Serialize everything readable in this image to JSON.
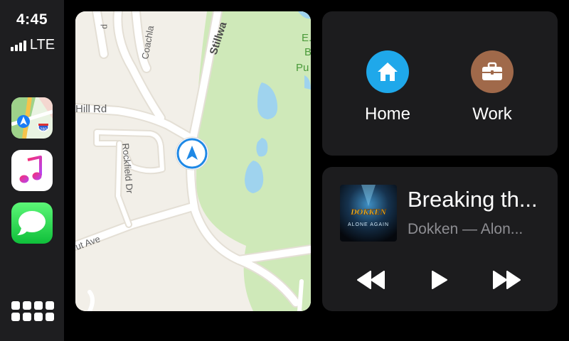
{
  "status": {
    "time": "4:45",
    "network": "LTE",
    "signal_bars": 4
  },
  "sidebar": {
    "apps": [
      {
        "name": "maps",
        "icon": "maps-app-icon",
        "badge": "280"
      },
      {
        "name": "music",
        "icon": "music-app-icon"
      },
      {
        "name": "messages",
        "icon": "messages-app-icon"
      }
    ],
    "launcher_icon": "app-grid-icon"
  },
  "map": {
    "labels": {
      "road_hill": "Hill Rd",
      "road_coachlamp": "Coachla",
      "road_stillwater": "Stillwa",
      "road_rockfield": "Rockfield Dr",
      "road_ave": "ut Ave",
      "park": "E.\nB\nPu",
      "top_left_fragment": "p"
    },
    "location_icon": "navigation-arrow-icon"
  },
  "destinations": [
    {
      "label": "Home",
      "icon": "house-icon",
      "color": "#1fa8ea"
    },
    {
      "label": "Work",
      "icon": "briefcase-icon",
      "color": "#a0694a"
    }
  ],
  "now_playing": {
    "title": "Breaking th...",
    "subtitle": "Dokken — Alon...",
    "album_art": {
      "band": "DOKKEN",
      "album": "ALONE AGAIN"
    },
    "controls": [
      "rewind-icon",
      "play-icon",
      "fast-forward-icon"
    ]
  },
  "colors": {
    "background": "#000000",
    "card": "#1c1c1e",
    "sidebar": "#1e1e20",
    "subtitle": "#8e8e93",
    "map_land": "#f2efe8",
    "map_park": "#cfe9b9",
    "map_water": "#9fd3ee"
  }
}
